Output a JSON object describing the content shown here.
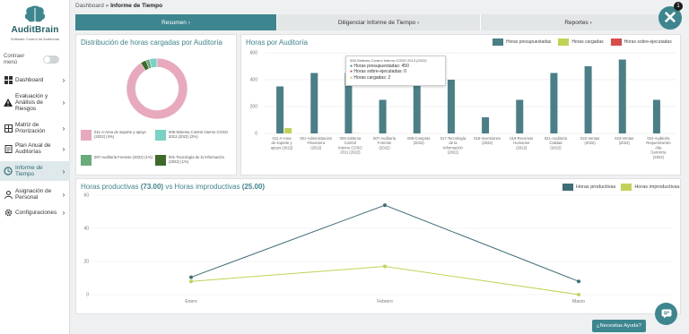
{
  "brand": {
    "name": "AuditBrain",
    "tagline": "Software Control de Auditorías",
    "accent": "#3d8690"
  },
  "sidebar": {
    "collapse_label": "Contraer menú",
    "items": [
      {
        "label": "Dashboard",
        "icon": "dashboard-icon"
      },
      {
        "label": "Evaluación y Análisis de Riesgos",
        "icon": "warning-icon"
      },
      {
        "label": "Matriz de Priorización",
        "icon": "matrix-icon"
      },
      {
        "label": "Plan Anual de Auditorías",
        "icon": "plan-icon"
      },
      {
        "label": "Informe de Tiempo",
        "icon": "time-report-icon"
      },
      {
        "label": "Asignación de Personal",
        "icon": "user-icon"
      },
      {
        "label": "Configuraciones",
        "icon": "gear-icon"
      }
    ]
  },
  "breadcrumb": {
    "root": "Dashboard",
    "separator": "»",
    "current": "Informe de Tiempo"
  },
  "tabs": [
    {
      "label": "Resumen"
    },
    {
      "label": "Diligenciar Informe de Tiempo"
    },
    {
      "label": "Reportes"
    }
  ],
  "close_badge": "1",
  "donut_card": {
    "title": "Distribución de horas cargadas por Auditoría",
    "colors": {
      "pink": "#e8a9bd",
      "teal": "#79d3c4",
      "green": "#6aab7c",
      "dark_green": "#3f6b2a"
    },
    "legend": [
      {
        "label": "011-A-Area de soporte y apoyo (2022)",
        "value": "(4%)"
      },
      {
        "label": "005-Sistema Control Interno COSO 2013 (2022)",
        "value": "(2%)"
      },
      {
        "label": "007-Auditoría Forense (2022)",
        "value": "(1%)"
      },
      {
        "label": "001-Tecnología de la Información (2022)",
        "value": "(1%)"
      }
    ]
  },
  "hours_card": {
    "title": "Horas por Auditoría",
    "legend": [
      {
        "label": "Horas presupuestadas",
        "color": "#4a7f87"
      },
      {
        "label": "Horas cargadas",
        "color": "#c2d257"
      },
      {
        "label": "Horas sobre-ejecutadas",
        "color": "#d94a4a"
      }
    ],
    "tooltip": {
      "title": "005-Sistema Control Interno COSO 2013 (2022)",
      "presupuestadas": "Horas presupuestadas: 450",
      "sobre": "Horas sobre-ejecutadas: 0",
      "cargadas": "Horas cargadas: 2"
    }
  },
  "productive_card": {
    "title_prefix": "Horas productivas",
    "productive_value": "(73.00)",
    "title_mid": "vs Horas improductivas",
    "unproductive_value": "(25.00)",
    "legend": [
      {
        "label": "Horas productivas",
        "color": "#3d6f78"
      },
      {
        "label": "Horas improductivas",
        "color": "#c2d257"
      }
    ]
  },
  "help_button": "¿Necesitas Ayuda?",
  "chart_data": [
    {
      "type": "pie",
      "title": "Distribución de horas cargadas por Auditoría",
      "categories": [
        "011-A-Area de soporte y apoyo (2022)",
        "005-Sistema Control Interno COSO 2013 (2022)",
        "007-Auditoría Forense (2022)",
        "001-Tecnología de la Información (2022)"
      ],
      "values": [
        91,
        4,
        2,
        3
      ]
    },
    {
      "type": "bar",
      "title": "Horas por Auditoría",
      "ylim": [
        0,
        600
      ],
      "yticks": [
        "0",
        "200",
        "400",
        "600"
      ],
      "categories": [
        "011-A-Area de soporte y apoyo (2022)",
        "001-Administracion Financiera (2022)",
        "005-Sistema Control Interno COSO 2011 (2022)",
        "007-Auditoría Forense (2022)",
        "008-Compras (2022)",
        "017-Tecnología de la Información (2022)",
        "018-Inversiones (2022)",
        "019-Recursos Humanos (2022)",
        "021-Auditoría Calidad (2022)",
        "022-Ventas (2022)",
        "023-Ventas (2022)",
        "024-Auditoría Requerimiento Alta Gerencia (2022)"
      ],
      "series": [
        {
          "name": "Horas presupuestadas",
          "values": [
            350,
            450,
            450,
            250,
            450,
            400,
            120,
            250,
            450,
            500,
            550,
            250
          ]
        },
        {
          "name": "Horas cargadas",
          "values": [
            40,
            0,
            2,
            0,
            0,
            0,
            0,
            0,
            0,
            0,
            0,
            0
          ]
        },
        {
          "name": "Horas sobre-ejecutadas",
          "values": [
            0,
            0,
            0,
            0,
            0,
            0,
            0,
            0,
            0,
            0,
            0,
            0
          ]
        }
      ]
    },
    {
      "type": "line",
      "title": "Horas productivas (73.00) vs Horas improductivas (25.00)",
      "ylim": [
        0,
        60
      ],
      "yticks": [
        "0",
        "20",
        "40",
        "60"
      ],
      "x": [
        "Enero",
        "Febrero",
        "Marzo"
      ],
      "series": [
        {
          "name": "Horas productivas",
          "values": [
            10.5,
            54,
            8
          ]
        },
        {
          "name": "Horas improductivas",
          "values": [
            8,
            17,
            0
          ]
        }
      ]
    }
  ]
}
